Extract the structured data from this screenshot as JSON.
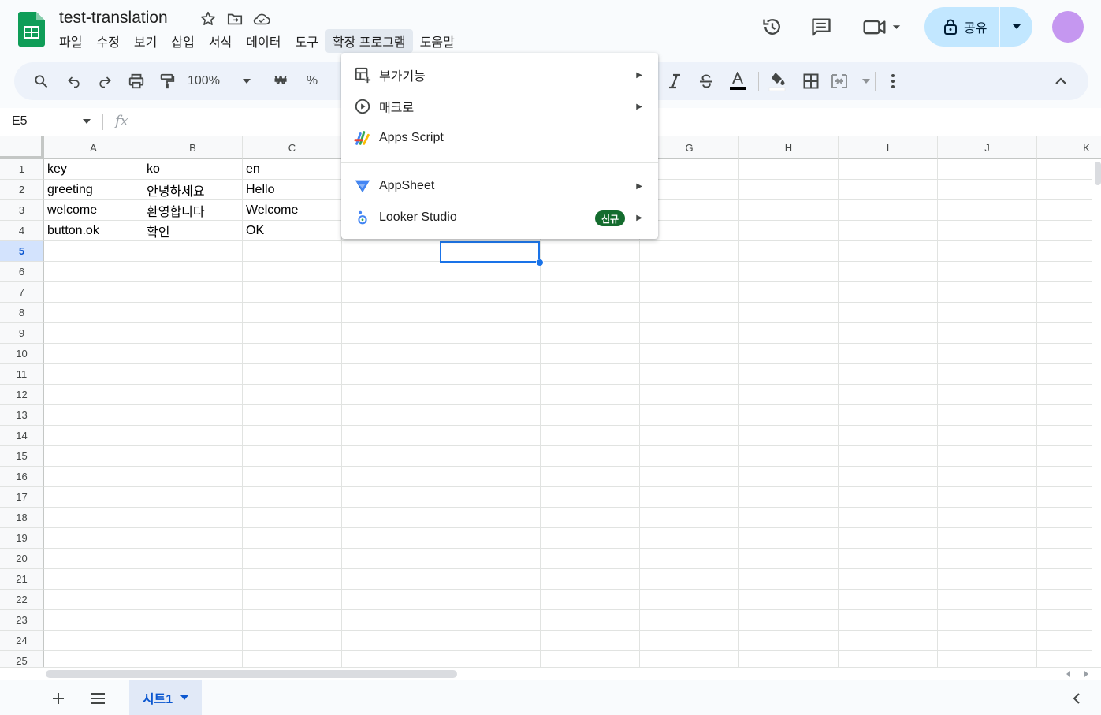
{
  "doc": {
    "title": "test-translation"
  },
  "menubar": [
    "파일",
    "수정",
    "보기",
    "삽입",
    "서식",
    "데이터",
    "도구",
    "확장 프로그램",
    "도움말"
  ],
  "menubar_active": "확장 프로그램",
  "share": {
    "label": "공유"
  },
  "toolbar": {
    "zoom": "100%",
    "currency": "₩",
    "percent": "%"
  },
  "formula_bar": {
    "name_box": "E5",
    "fx": "fx",
    "value": ""
  },
  "columns": [
    "A",
    "B",
    "C",
    "D",
    "E",
    "F",
    "G",
    "H",
    "I",
    "J",
    "K"
  ],
  "rows": [
    "1",
    "2",
    "3",
    "4",
    "5",
    "6",
    "7",
    "8",
    "9",
    "10",
    "11",
    "12",
    "13",
    "14",
    "15",
    "16",
    "17",
    "18",
    "19",
    "20",
    "21",
    "22",
    "23",
    "24",
    "25"
  ],
  "selected_row": "5",
  "cells": [
    [
      "key",
      "ko",
      "en"
    ],
    [
      "greeting",
      "안녕하세요",
      "Hello"
    ],
    [
      "welcome",
      "환영합니다",
      "Welcome"
    ],
    [
      "button.ok",
      "확인",
      "OK"
    ]
  ],
  "extensions_menu": {
    "items": [
      {
        "label": "부가기능",
        "icon": "addon-icon",
        "submenu": true
      },
      {
        "label": "매크로",
        "icon": "macro-play-icon",
        "submenu": true
      },
      {
        "label": "Apps Script",
        "icon": "apps-script-icon",
        "submenu": false
      },
      {
        "label": "AppSheet",
        "icon": "appsheet-icon",
        "submenu": true
      },
      {
        "label": "Looker Studio",
        "icon": "looker-studio-icon",
        "submenu": true,
        "badge": "신규"
      }
    ]
  },
  "sheet_tabs": [
    {
      "label": "시트1"
    }
  ],
  "colors": {
    "accent": "#0b57d0",
    "selection": "#1a73e8",
    "share_bg": "#c2e7ff",
    "badge_bg": "#146c2e",
    "avatar": "#c597f0",
    "sheets_green": "#0f9d58"
  }
}
